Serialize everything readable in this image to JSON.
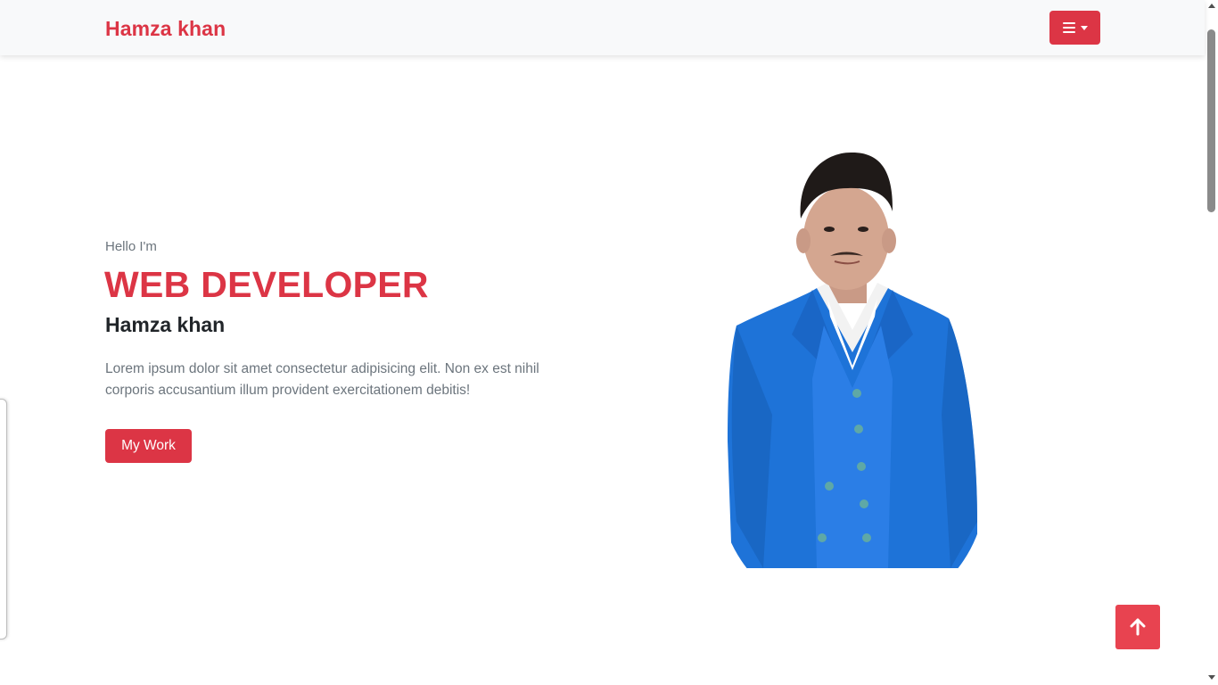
{
  "navbar": {
    "brand": "Hamza khan",
    "menu_icon": "hamburger-menu-icon",
    "dropdown_icon": "caret-down-icon"
  },
  "hero": {
    "greeting": "Hello I'm",
    "title": "WEB DEVELOPER",
    "name": "Hamza khan",
    "description": "Lorem ipsum dolor sit amet consectetur adipisicing elit. Non ex est nihil corporis accusantium illum provident exercitationem debitis!",
    "button_label": "My Work"
  },
  "scroll_top": {
    "icon": "arrow-up-icon"
  },
  "colors": {
    "accent": "#dc3545",
    "scroll_top_bg": "#e84350",
    "navbar_bg": "#f8f9fa",
    "heading_dark": "#212529",
    "muted_text": "#6c757d",
    "suit_blue": "#1e73d8"
  }
}
